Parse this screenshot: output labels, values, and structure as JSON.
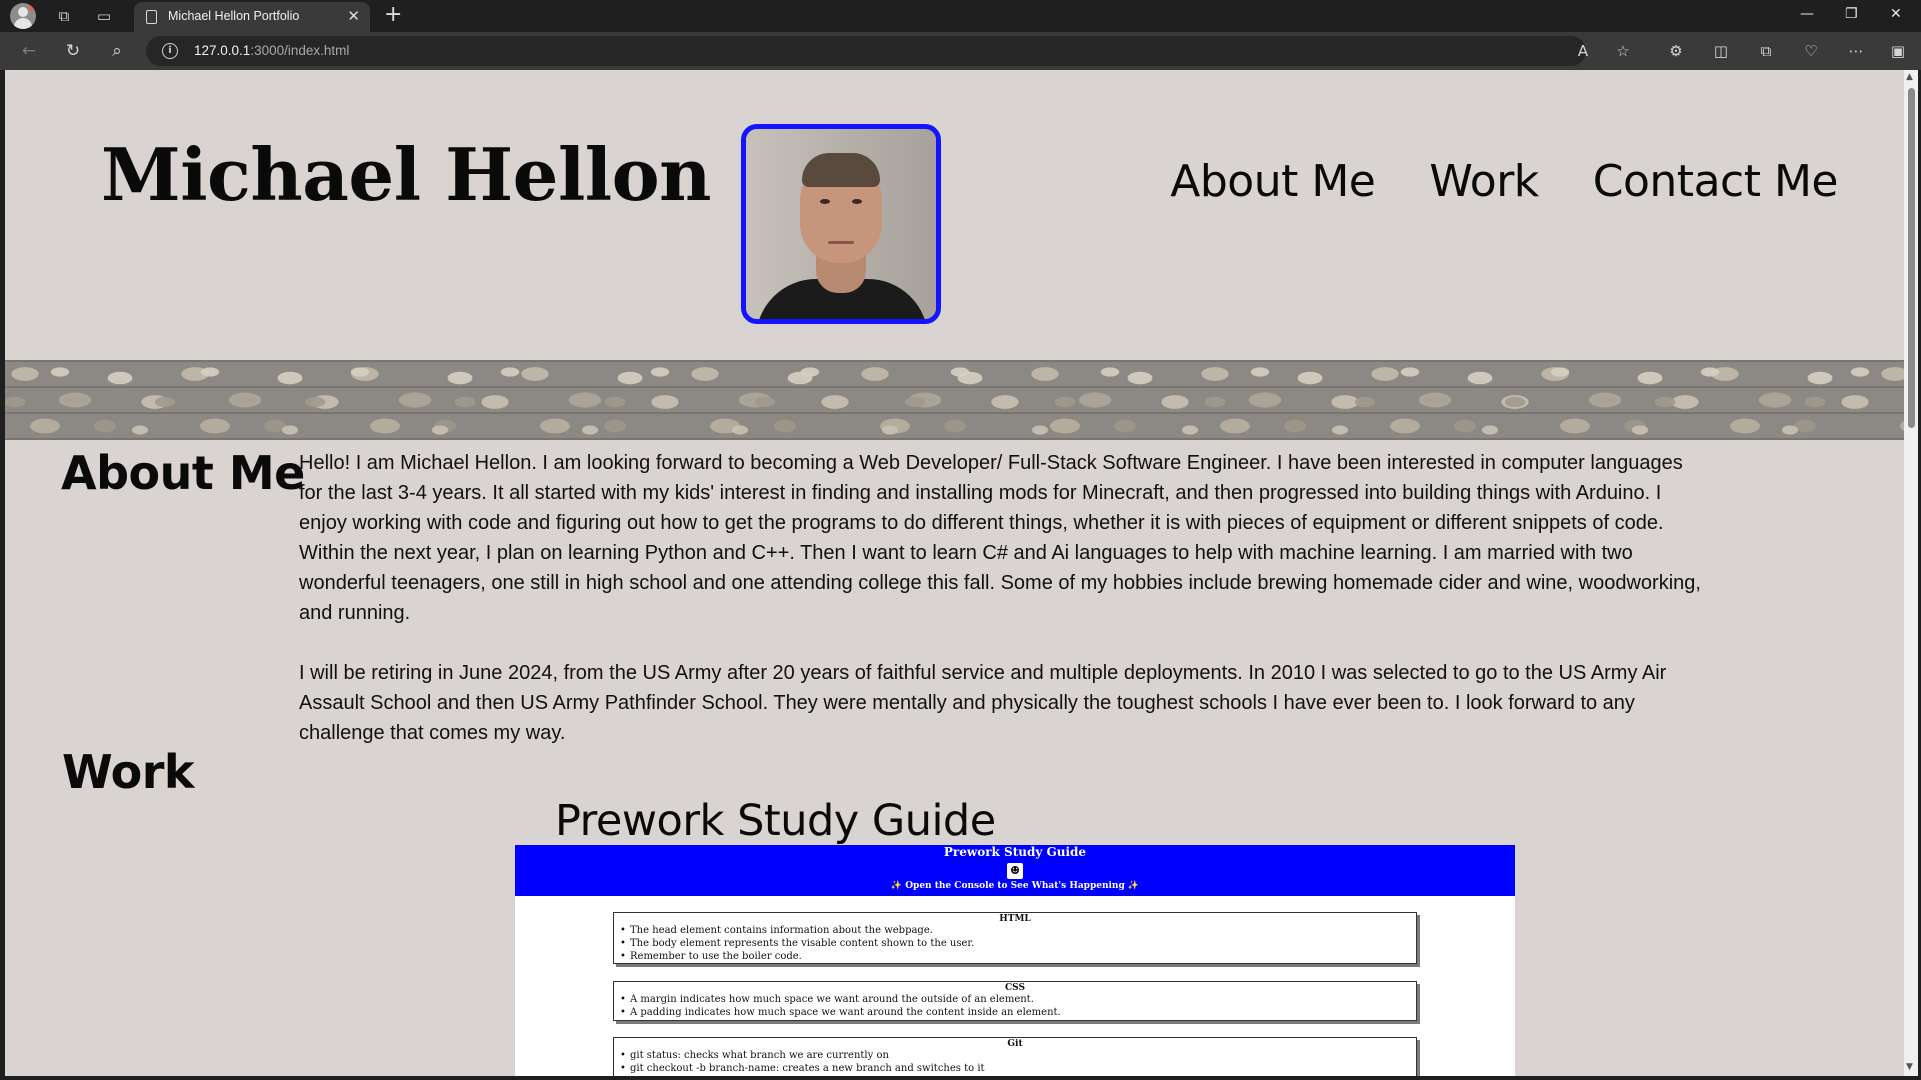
{
  "browser": {
    "tab_title": "Michael Hellon Portfolio",
    "url_host": "127.0.0.1",
    "url_rest": ":3000/index.html"
  },
  "site": {
    "name": "Michael Hellon",
    "nav": [
      "About Me",
      "Work",
      "Contact Me"
    ]
  },
  "about": {
    "heading": "About Me",
    "paragraphs": [
      "Hello! I am Michael Hellon. I am looking forward to becoming a Web Developer/ Full-Stack Software Engineer. I have been interested in computer languages for the last 3-4 years. It all started with my kids' interest in finding and installing mods for Minecraft, and then progressed into building things with Arduino. I enjoy working with code and figuring out how to get the programs to do different things, whether it is with pieces of equipment or different snippets of code. Within the next year, I plan on learning Python and C++. Then I want to learn C# and Ai languages to help with machine learning. I am married with two wonderful teenagers, one still in high school and one attending college this fall. Some of my hobbies include brewing homemade cider and wine, woodworking, and running.",
      "I will be retiring in June 2024, from the US Army after 20 years of faithful service and multiple deployments. In 2010 I was selected to go to the US Army Air Assault School and then US Army Pathfinder School. They were mentally and physically the toughest schools I have ever been to. I look forward to any challenge that comes my way."
    ]
  },
  "work": {
    "heading": "Work",
    "project_title": "Prework Study Guide",
    "preview": {
      "title": "Prework Study Guide",
      "subtitle": "✨ Open the Console to See What's Happening ✨",
      "cards": [
        {
          "heading": "HTML",
          "items": [
            "The head element contains information about the webpage.",
            "The body element represents the visable content shown to the user.",
            "Remember to use the boiler code."
          ]
        },
        {
          "heading": "CSS",
          "items": [
            "A margin indicates how much space we want around the outside of an element.",
            "A padding indicates how much space we want around the content inside an element."
          ]
        },
        {
          "heading": "Git",
          "items": [
            "git status: checks what branch we are currently on",
            "git checkout -b branch-name: creates a new branch and switches to it"
          ]
        }
      ]
    }
  },
  "colors": {
    "page_bg": "#d9d4d1",
    "portrait_border": "#1414ff",
    "preview_header": "#0000ff"
  }
}
